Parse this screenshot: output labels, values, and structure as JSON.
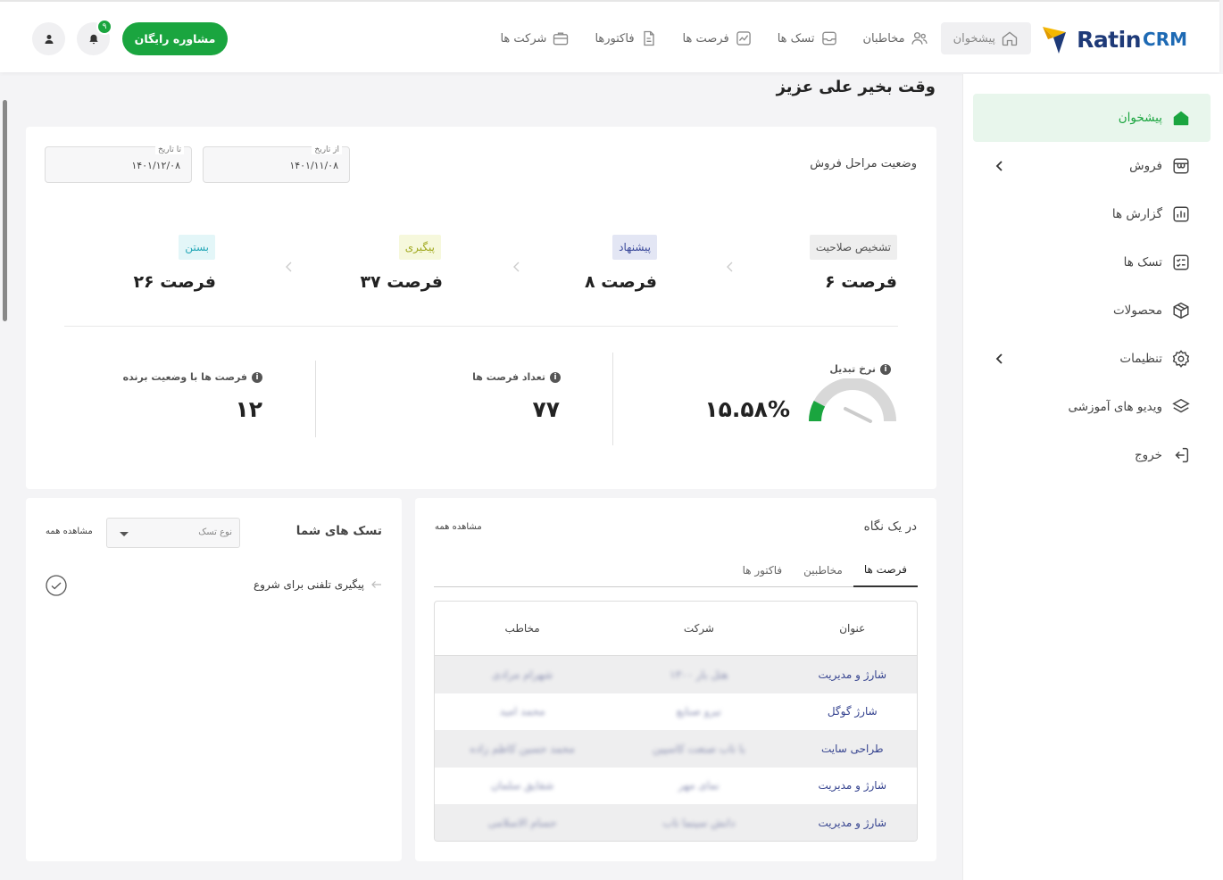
{
  "header": {
    "logo_text": "Ratin",
    "logo_suffix": "CRM",
    "nav": [
      {
        "label": "پیشخوان",
        "icon": "home-icon",
        "active": true
      },
      {
        "label": "مخاطبان",
        "icon": "users-icon"
      },
      {
        "label": "تسک ها",
        "icon": "tasks-icon"
      },
      {
        "label": "فرصت ها",
        "icon": "chart-icon"
      },
      {
        "label": "فاکتورها",
        "icon": "invoice-icon"
      },
      {
        "label": "شرکت ها",
        "icon": "briefcase-icon"
      }
    ],
    "consult_label": "مشاوره رایگان",
    "notification_count": "۹"
  },
  "sidebar": {
    "items": [
      {
        "label": "پیشخوان",
        "icon": "home-icon",
        "active": true
      },
      {
        "label": "فروش",
        "icon": "shop-icon",
        "expandable": true
      },
      {
        "label": "گزارش ها",
        "icon": "report-icon"
      },
      {
        "label": "تسک ها",
        "icon": "tasks-icon"
      },
      {
        "label": "محصولات",
        "icon": "box-icon"
      },
      {
        "label": "تنظیمات",
        "icon": "gear-icon",
        "expandable": true
      },
      {
        "label": "ویدیو های آموزشی",
        "icon": "video-icon"
      },
      {
        "label": "خروج",
        "icon": "logout-icon"
      }
    ]
  },
  "greeting": "وقت بخیر علی عزیز",
  "sales_stages": {
    "title": "وضعیت مراحل فروش",
    "from_label": "از تاریخ",
    "from_value": "۱۴۰۱/۱۱/۰۸",
    "to_label": "تا تاریخ",
    "to_value": "۱۴۰۱/۱۲/۰۸",
    "stages": [
      {
        "name": "تشخیص صلاحیت",
        "count": "۶ فرصت",
        "bg": "#eeeeee",
        "fg": "#555555"
      },
      {
        "name": "پیشنهاد",
        "count": "۸ فرصت",
        "bg": "#e3e6f4",
        "fg": "#3b4a9b"
      },
      {
        "name": "پیگیری",
        "count": "۳۷ فرصت",
        "bg": "#f6f8dc",
        "fg": "#a0a81e"
      },
      {
        "name": "بستن",
        "count": "۲۶ فرصت",
        "bg": "#e3f6f8",
        "fg": "#27a8b8"
      }
    ],
    "kpis": {
      "conversion_label": "نرخ تبدیل",
      "conversion_value": "۱۵.۵۸%",
      "conversion_fraction": 0.1558,
      "count_label": "تعداد فرصت ها",
      "count_value": "۷۷",
      "won_label": "فرصت ها با وضعیت برنده",
      "won_value": "۱۲"
    },
    "colors": {
      "gauge_fill": "#1aa53f",
      "gauge_track": "#d8d8d8"
    }
  },
  "glance": {
    "title": "در یک نگاه",
    "view_all": "مشاهده همه",
    "tabs": [
      "فرصت ها",
      "مخاطبین",
      "فاکتور ها"
    ],
    "columns": [
      "عنوان",
      "شرکت",
      "مخاطب"
    ],
    "rows": [
      [
        "شارژ و مدیریت",
        "هتل بار ۱۳۰۰",
        "شهرام مرادی"
      ],
      [
        "شارژ گوگل",
        "نیرو صنایع",
        "محمد امید"
      ],
      [
        "طراحی سایت",
        "با تاب صنعت کاسپین",
        "محمد حسین کاظم زاده"
      ],
      [
        "شارژ و مدیریت",
        "نمای مهر",
        "شقایق سلمان"
      ],
      [
        "شارژ و مدیریت",
        "دانش سینما تاب",
        "حسام الاسلامی"
      ]
    ]
  },
  "tasks": {
    "title": "تسک های شما",
    "view_all": "مشاهده همه",
    "type_placeholder": "نوع تسک",
    "items": [
      {
        "label": "پیگیری تلفنی برای شروع"
      }
    ]
  }
}
